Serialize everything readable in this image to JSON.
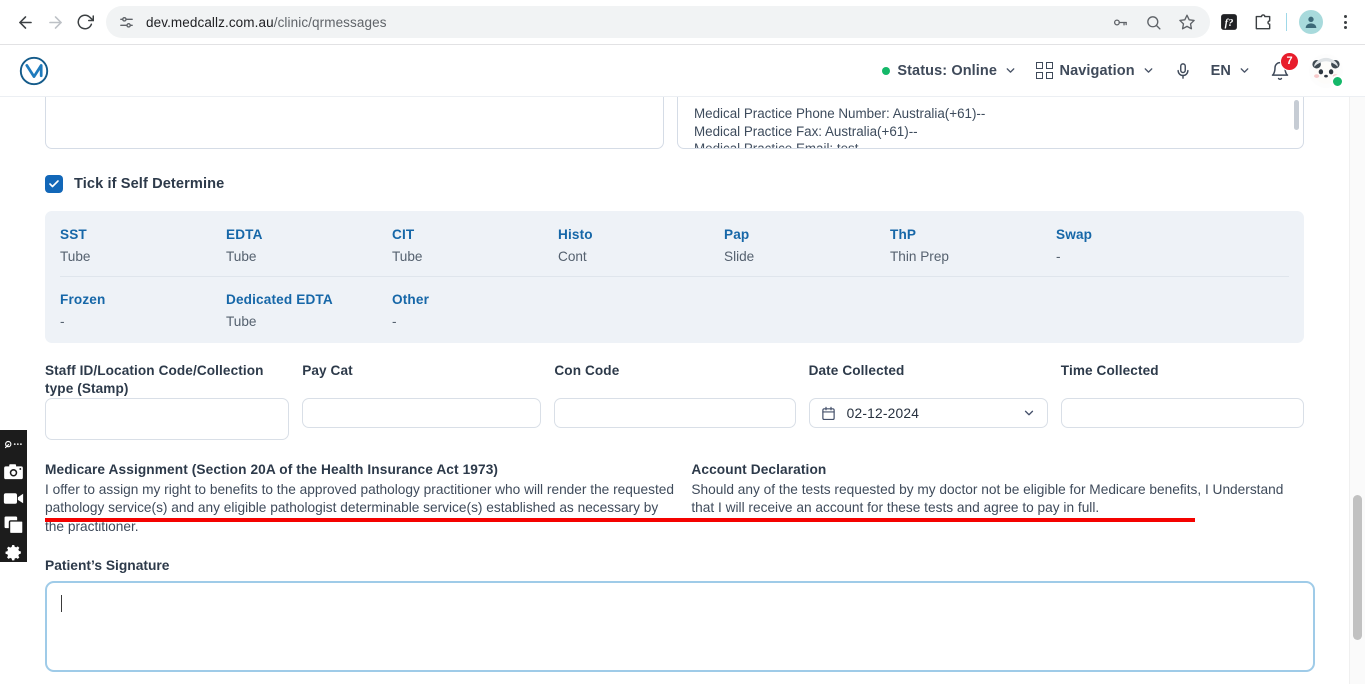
{
  "browser": {
    "back_tooltip": "Back",
    "forward_tooltip": "Forward",
    "reload_tooltip": "Reload",
    "url_host": "dev.medcallz.com.au",
    "url_path": "/clinic/qrmessages",
    "icons": {
      "site_settings": "tune-icon",
      "password": "key-icon",
      "zoom": "search-icon",
      "bookmark": "star-icon",
      "extension_fn": "fn-extension-icon",
      "extensions": "puzzle-icon",
      "profile": "profile-avatar-icon",
      "menu": "three-dots-menu-icon"
    }
  },
  "app_header": {
    "logo": "medcallz-m-logo",
    "status_label": "Status: Online",
    "status_color": "#14b869",
    "navigation_label": "Navigation",
    "mic_icon": "microphone-icon",
    "language": "EN",
    "notification_count": "7",
    "notification_color": "#e81d2c",
    "avatar": "panda-avatar"
  },
  "capture_toolbar": {
    "items": [
      {
        "icon": "pen-more-icon"
      },
      {
        "icon": "camera-icon"
      },
      {
        "icon": "video-camera-icon"
      },
      {
        "icon": "window-capture-icon"
      },
      {
        "icon": "gear-icon"
      }
    ]
  },
  "practice_panel": {
    "lines": [
      "Medical Practice Phone Number: Australia(+61)--",
      "Medical Practice Fax: Australia(+61)--",
      "Medical Practice Email: test"
    ]
  },
  "self_determine": {
    "label": "Tick if Self Determine",
    "checked": true
  },
  "specimen_table": {
    "rows": [
      [
        {
          "key": "SST",
          "value": "Tube"
        },
        {
          "key": "EDTA",
          "value": "Tube"
        },
        {
          "key": "CIT",
          "value": "Tube"
        },
        {
          "key": "Histo",
          "value": "Cont"
        },
        {
          "key": "Pap",
          "value": "Slide"
        },
        {
          "key": "ThP",
          "value": "Thin Prep"
        },
        {
          "key": "Swap",
          "value": "-"
        }
      ],
      [
        {
          "key": "Frozen",
          "value": "-"
        },
        {
          "key": "Dedicated EDTA",
          "value": "Tube"
        },
        {
          "key": "Other",
          "value": "-"
        }
      ]
    ]
  },
  "form": {
    "staff_id": {
      "label": "Staff ID/Location Code/Collection type (Stamp)",
      "value": ""
    },
    "pay_cat": {
      "label": "Pay Cat",
      "value": ""
    },
    "con_code": {
      "label": "Con Code",
      "value": ""
    },
    "date_collected": {
      "label": "Date Collected",
      "value": "02-12-2024",
      "icon": "calendar-icon",
      "chevron": "chevron-down-icon"
    },
    "time_collected": {
      "label": "Time Collected",
      "value": ""
    }
  },
  "annotation": {
    "line_color": "#f40200"
  },
  "declarations": {
    "medicare": {
      "title": "Medicare Assignment (Section 20A of the Health Insurance Act 1973)",
      "body": "I offer to assign my right to benefits to the approved pathology practitioner who will render the requested pathology service(s) and any eligible pathologist determinable service(s) established as necessary by the practitioner."
    },
    "account": {
      "title": "Account Declaration",
      "body": "Should any of the tests requested by my doctor not be eligible for Medicare benefits, I Understand that I will receive an account for these tests and agree to pay in full."
    }
  },
  "signature": {
    "label": "Patient’s Signature",
    "value": "",
    "focused": true,
    "focus_color": "#9fcbe8"
  }
}
